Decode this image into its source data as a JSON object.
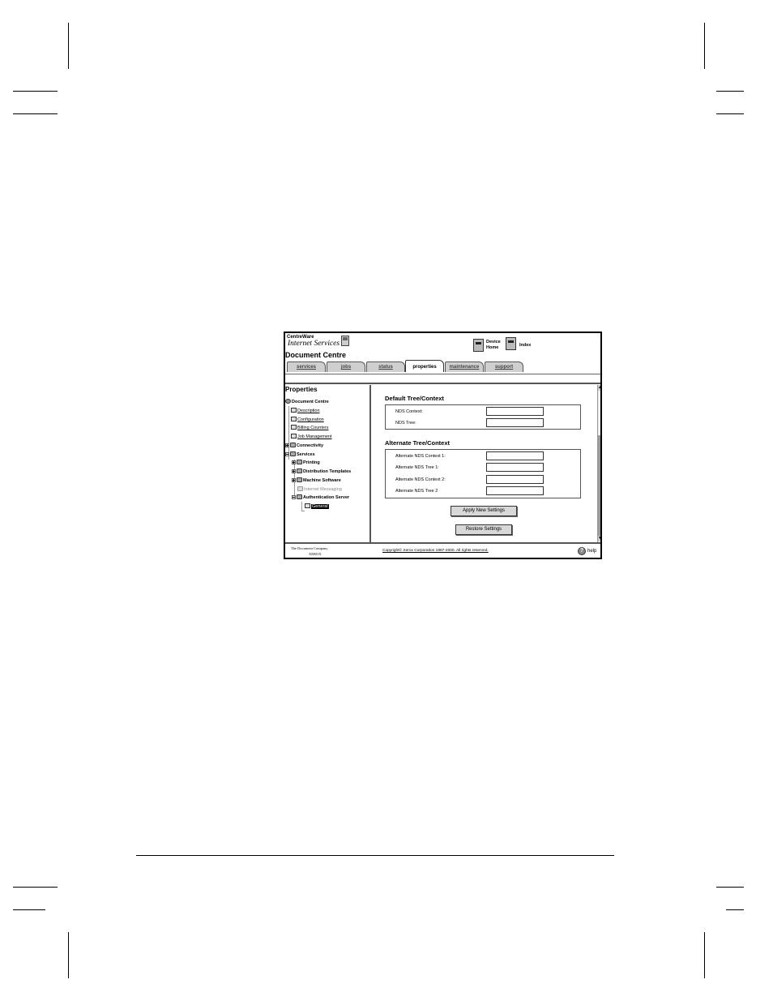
{
  "app": {
    "brand_line1": "CentreWare",
    "brand_line2": "Internet Services",
    "device_name": "Document Centre",
    "nav": {
      "device_home_line1": "Device",
      "device_home_line2": "Home",
      "index": "Index"
    }
  },
  "tabs": [
    {
      "label": "services",
      "active": false
    },
    {
      "label": "jobs",
      "active": false
    },
    {
      "label": "status",
      "active": false
    },
    {
      "label": "properties",
      "active": true
    },
    {
      "label": "maintenance",
      "active": false
    },
    {
      "label": "support",
      "active": false
    }
  ],
  "sidebar": {
    "title": "Properties",
    "items": [
      {
        "label": "Document Centre"
      },
      {
        "label": "Description"
      },
      {
        "label": "Configuration"
      },
      {
        "label": "Billing Counters"
      },
      {
        "label": "Job Management"
      },
      {
        "label": "Connectivity"
      },
      {
        "label": "Services"
      },
      {
        "label": "Printing"
      },
      {
        "label": "Distribution Templates"
      },
      {
        "label": "Machine Software"
      },
      {
        "label": "Internet Messaging"
      },
      {
        "label": "Authentication Server"
      },
      {
        "label": "General",
        "selected": true
      }
    ]
  },
  "main": {
    "default_section": {
      "title": "Default Tree/Context",
      "fields": [
        {
          "label": "NDS Context:",
          "value": ""
        },
        {
          "label": "NDS Tree:",
          "value": ""
        }
      ]
    },
    "alternate_section": {
      "title": "Alternate Tree/Context",
      "fields": [
        {
          "label": "Alternate NDS Context 1:",
          "value": ""
        },
        {
          "label": "Alternate NDS Tree 1:",
          "value": ""
        },
        {
          "label": "Alternate NDS Context 2:",
          "value": ""
        },
        {
          "label": "Alternate NDS Tree 2",
          "value": ""
        }
      ]
    },
    "apply_button": "Apply New Settings",
    "restore_button": "Restore Settings"
  },
  "footer": {
    "company_line1": "The Document Company",
    "company_line2": "XEROX",
    "copyright": "Copyright© Xerox Corporation 1987-2000. All rights reserved.",
    "help": "help"
  }
}
